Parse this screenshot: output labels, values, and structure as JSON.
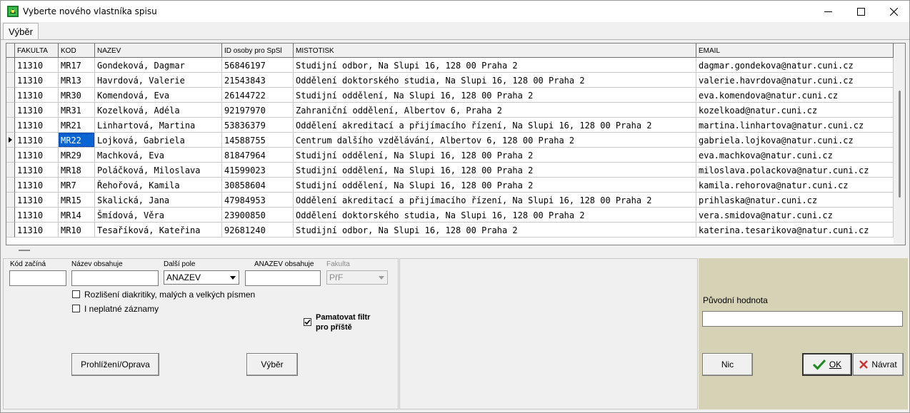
{
  "window": {
    "title": "Vyberte nového vlastníka spisu"
  },
  "tabs": [
    {
      "label": "Výběr"
    }
  ],
  "grid": {
    "columns": [
      "FAKULTA",
      "KOD",
      "NAZEV",
      "ID osoby pro SpSl",
      "MISTOTISK",
      "EMAIL"
    ],
    "rows": [
      [
        "11310",
        "MR17",
        "Gondeková, Dagmar",
        "56846197",
        "Studijní odbor, Na Slupi 16, 128 00 Praha 2",
        "dagmar.gondekova@natur.cuni.cz"
      ],
      [
        "11310",
        "MR13",
        "Havrdová, Valerie",
        "21543843",
        "Oddělení doktorského studia, Na Slupi 16, 128 00 Praha 2",
        "valerie.havrdova@natur.cuni.cz"
      ],
      [
        "11310",
        "MR30",
        "Komendová, Eva",
        "26144722",
        "Studijní oddělení, Na Slupi 16, 128 00 Praha 2",
        "eva.komendova@natur.cuni.cz"
      ],
      [
        "11310",
        "MR31",
        "Kozelková, Adéla",
        "92197970",
        "Zahraniční oddělení, Albertov 6, Praha 2",
        "kozelkoad@natur.cuni.cz"
      ],
      [
        "11310",
        "MR21",
        "Linhartová, Martina",
        "53836379",
        "Oddělení akreditací a přijímacího řízení, Na Slupi 16, 128 00 Praha 2",
        "martina.linhartova@natur.cuni.cz"
      ],
      [
        "11310",
        "MR22",
        "Lojková, Gabriela",
        "14588755",
        "Centrum dalšího vzdělávání, Albertov 6, 128 00 Praha 2",
        "gabriela.lojkova@natur.cuni.cz"
      ],
      [
        "11310",
        "MR29",
        "Machková, Eva",
        "81847964",
        "Studijní oddělení, Na Slupi 16, 128 00 Praha 2",
        "eva.machkova@natur.cuni.cz"
      ],
      [
        "11310",
        "MR18",
        "Poláčková, Miloslava",
        "41599023",
        "Studijní oddělení, Na Slupi 16, 128 00 Praha 2",
        "miloslava.polackova@natur.cuni.cz"
      ],
      [
        "11310",
        "MR7",
        "Řehořová, Kamila",
        "30858604",
        "Studijní oddělení, Na Slupi 16, 128 00 Praha 2",
        "kamila.rehorova@natur.cuni.cz"
      ],
      [
        "11310",
        "MR15",
        "Skalická, Jana",
        "47984953",
        "Oddělení akreditací a přijímacího řízení, Na Slupi 16, 128 00 Praha 2",
        "prihlaska@natur.cuni.cz"
      ],
      [
        "11310",
        "MR14",
        "Šmídová, Věra",
        "23900850",
        "Oddělení doktorského studia, Na Slupi 16, 128 00 Praha 2",
        "vera.smidova@natur.cuni.cz"
      ],
      [
        "11310",
        "MR10",
        "Tesaříková, Kateřina",
        "92681240",
        "Studijní odbor, Na Slupi 16, 128 00 Praha 2",
        "katerina.tesarikova@natur.cuni.cz"
      ]
    ],
    "selected_row": 5
  },
  "filter": {
    "kod_label": "Kód začíná",
    "kod_value": "",
    "nazev_label": "Název obsahuje",
    "nazev_value": "",
    "dalsi_label": "Další pole",
    "dalsi_value": "ANAZEV",
    "anazev_label": "ANAZEV obsahuje",
    "anazev_value": "",
    "fakulta_label": "Fakulta",
    "fakulta_value": "PřF",
    "diakritika_label": "Rozlišení diakritiky, malých a velkých písmen",
    "diakritika_checked": false,
    "neplatne_label": "I neplatné záznamy",
    "neplatne_checked": false,
    "pamatovat_label_1": "Pamatovat filtr",
    "pamatovat_label_2": "pro příště",
    "pamatovat_checked": true,
    "prohlizeni_button": "Prohlížení/Oprava",
    "vyber_button": "Výběr"
  },
  "right": {
    "puvodni_label": "Původní hodnota",
    "puvodni_value": "",
    "nic_button": "Nic",
    "ok_button": "OK",
    "navrat_button": "Návrat"
  },
  "colors": {
    "selection": "#0a64d2",
    "right_panel_bg": "#d6d2b5",
    "ok_check": "#1a8a1a",
    "navrat_x": "#d03030"
  }
}
